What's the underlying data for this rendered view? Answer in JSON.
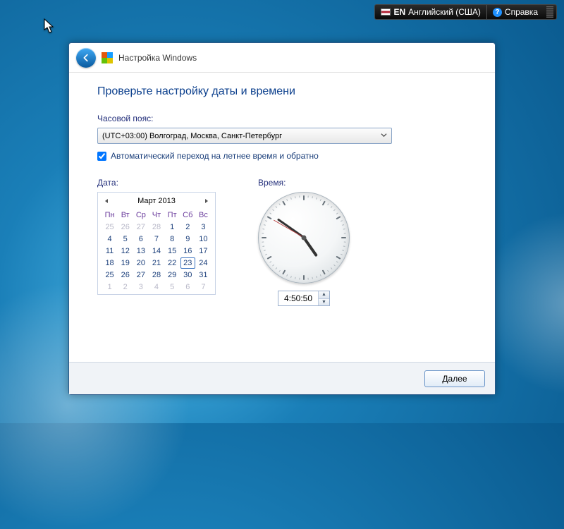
{
  "taskbar": {
    "lang_code": "EN",
    "lang_name": "Английский (США)",
    "help_label": "Справка"
  },
  "window": {
    "title": "Настройка Windows",
    "heading": "Проверьте настройку даты и времени",
    "tz_label": "Часовой пояс:",
    "tz_value": "(UTC+03:00) Волгоград, Москва, Санкт-Петербург",
    "dst_label": "Автоматический переход на летнее время и обратно",
    "dst_checked": true,
    "date_label": "Дата:",
    "time_label": "Время:",
    "next_label": "Далее"
  },
  "calendar": {
    "month_title": "Март 2013",
    "dow": [
      "Пн",
      "Вт",
      "Ср",
      "Чт",
      "Пт",
      "Сб",
      "Вс"
    ],
    "leading": [
      25,
      26,
      27,
      28
    ],
    "days_in_month": 31,
    "trailing": [
      1,
      2,
      3,
      4,
      5,
      6,
      7
    ],
    "selected_day": 23
  },
  "clock": {
    "time_text": "4:50:50",
    "hours": 4,
    "minutes": 50,
    "seconds": 50
  }
}
